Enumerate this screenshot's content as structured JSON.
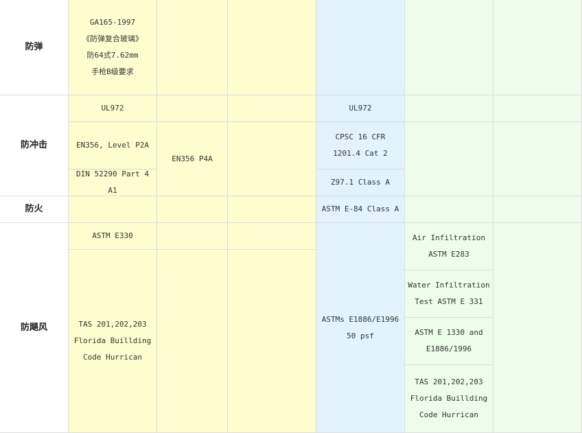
{
  "colors": {
    "yellow": "#fdfdcf",
    "blue": "#e2f3fd",
    "green": "#eefdea",
    "border": "#dddddd",
    "header_bg": "#ffffff"
  },
  "rows": {
    "bulletproof": "防弹",
    "impact": "防冲击",
    "fire": "防火",
    "hurricane": "防飓风"
  },
  "cells": {
    "bp_std": "GA165-1997\n《防弹复合玻璃》\n防64式7.62mm\n手枪B级要求",
    "imp_ul": "UL972",
    "imp_en356_p2a": "EN356, Level P2A",
    "imp_en356_p4a": "EN356 P4A",
    "imp_din": "DIN 52290 Part 4 A1",
    "imp_ul_b": "UL972",
    "imp_cpsc": "CPSC 16 CFR\n1201.4 Cat 2",
    "imp_z97": "Z97.1 Class A",
    "fire_astm": "ASTM E-84 Class A",
    "hur_astm_e330": "ASTM E330",
    "hur_tas_y": "TAS 201,202,203\nFlorida Buillding\nCode Hurrican",
    "hur_astms_b": "ASTMs E1886/E1996\n50 psf",
    "hur_air": "Air Infiltration\nASTM E283",
    "hur_water": "Water Infiltration\nTest ASTM E 331",
    "hur_astm_1330": "ASTM E 1330 and\nE1886/1996",
    "hur_tas_g": "TAS 201,202,203\nFlorida Buillding\nCode Hurrican"
  }
}
